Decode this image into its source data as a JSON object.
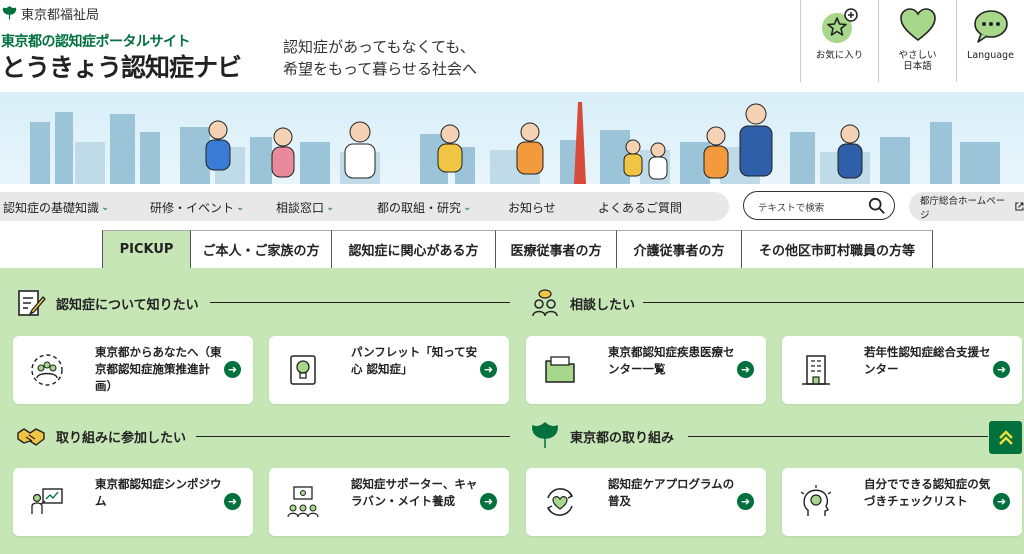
{
  "header": {
    "agency": "東京都福祉局",
    "subtitle": "東京都の認知症ポータルサイト",
    "site_title": "とうきょう認知症ナビ",
    "tagline_1": "認知症があってもなくても、",
    "tagline_2": "希望をもって暮らせる社会へ",
    "favorites_label": "お気に入り",
    "easy_japanese_label_1": "やさしい",
    "easy_japanese_label_2": "日本語",
    "language_label": "Language"
  },
  "nav": {
    "items": [
      {
        "label": "認知症の基礎知識",
        "chevron": true
      },
      {
        "label": "研修・イベント",
        "chevron": true
      },
      {
        "label": "相談窓口",
        "chevron": true
      },
      {
        "label": "都の取組・研究",
        "chevron": true
      },
      {
        "label": "お知らせ",
        "chevron": false
      },
      {
        "label": "よくあるご質問",
        "chevron": false
      }
    ],
    "search_placeholder": "テキストで検索",
    "home_link": "都庁総合ホームページ"
  },
  "tabs": [
    "PICKUP",
    "ご本人・ご家族の方",
    "認知症に関心がある方",
    "医療従事者の方",
    "介護従事者の方",
    "その他区市町村職員の方等"
  ],
  "sections": {
    "learn": "認知症について知りたい",
    "consult": "相談したい",
    "participate": "取り組みに参加したい",
    "tokyo": "東京都の取り組み"
  },
  "cards": [
    {
      "text": "東京都からあなたへ（東京都認知症施策推進計画）",
      "icon": "community-icon"
    },
    {
      "text": "パンフレット「知って安心 認知症」",
      "icon": "lightbulb-book-icon"
    },
    {
      "text": "東京都認知症疾患医療センター一覧",
      "icon": "folder-icon"
    },
    {
      "text": "若年性認知症総合支援センター",
      "icon": "building-icon"
    },
    {
      "text": "東京都認知症シンポジウム",
      "icon": "presentation-icon"
    },
    {
      "text": "認知症サポーター、キャラバン・メイト養成",
      "icon": "training-icon"
    },
    {
      "text": "認知症ケアプログラムの普及",
      "icon": "heart-cycle-icon"
    },
    {
      "text": "自分でできる認知症の気づきチェックリスト",
      "icon": "head-check-icon"
    }
  ],
  "colors": {
    "brand_green": "#00713d",
    "panel_green": "#c7e6b5"
  }
}
